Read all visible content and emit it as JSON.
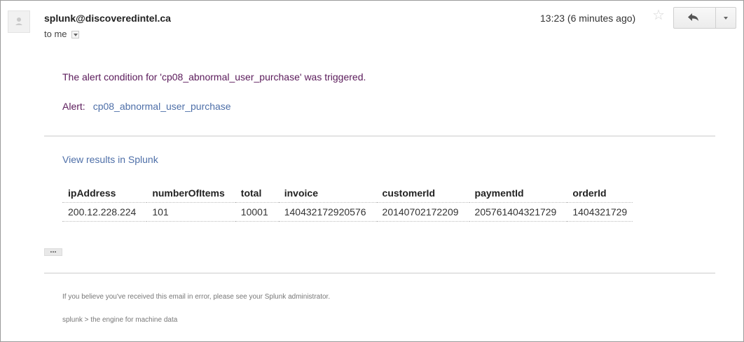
{
  "header": {
    "sender": "splunk@discoveredintel.ca",
    "recipient": "to me",
    "timestamp": "13:23 (6 minutes ago)",
    "star_icon": "star-icon",
    "reply_icon": "reply-icon"
  },
  "body": {
    "alert_message": "The alert condition for 'cp08_abnormal_user_purchase' was triggered.",
    "alert_label": "Alert:",
    "alert_name": "cp08_abnormal_user_purchase",
    "view_results": "View results in Splunk",
    "ellipsis": "...",
    "table": {
      "columns": [
        "ipAddress",
        "numberOfItems",
        "total",
        "invoice",
        "customerId",
        "paymentId",
        "orderId"
      ],
      "rows": [
        [
          "200.12.228.224",
          "101",
          "10001",
          "140432172920576",
          "20140702172209",
          "205761404321729",
          "1404321729"
        ]
      ]
    }
  },
  "footer": {
    "note": "If you believe you've received this email in error, please see your Splunk administrator.",
    "tagline": "splunk > the engine for machine data"
  },
  "colors": {
    "alert_text": "#5a1a5a",
    "link": "#4e6fa8",
    "divider": "#cccccc"
  }
}
